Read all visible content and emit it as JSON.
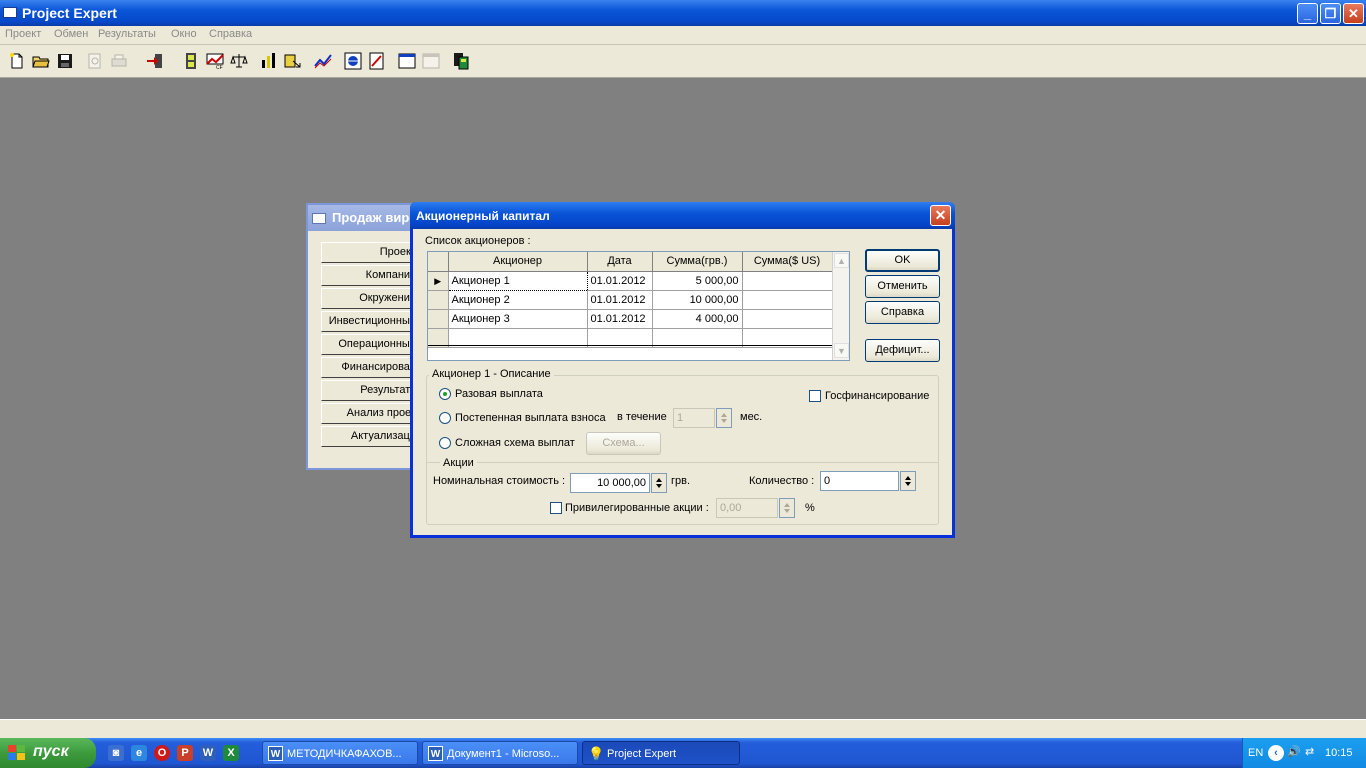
{
  "app": {
    "title": "Project Expert"
  },
  "menu": [
    "Проект",
    "Обмен",
    "Результаты",
    "Окно",
    "Справка"
  ],
  "project_window": {
    "title": "Продаж виро",
    "buttons": [
      "Проект",
      "Компания",
      "Окружение",
      "Инвестиционный",
      "Операционный",
      "Финансирован",
      "Результать",
      "Анализ проек",
      "Актуализаци"
    ]
  },
  "dialog": {
    "title": "Акционерный капитал",
    "list_label": "Список акционеров :",
    "columns": [
      "Акционер",
      "Дата",
      "Сумма(грв.)",
      "Сумма($ US)"
    ],
    "rows": [
      {
        "name": "Акционер 1",
        "date": "01.01.2012",
        "sum": "5 000,00",
        "sum_usd": ""
      },
      {
        "name": "Акционер 2",
        "date": "01.01.2012",
        "sum": "10 000,00",
        "sum_usd": ""
      },
      {
        "name": "Акционер 3",
        "date": "01.01.2012",
        "sum": "4 000,00",
        "sum_usd": ""
      }
    ],
    "buttons": {
      "ok": "OK",
      "cancel": "Отменить",
      "help": "Справка",
      "deficit": "Дефицит..."
    },
    "description": {
      "caption": "Акционер 1 - Описание",
      "one_time": "Разовая выплата",
      "gradual": "Постепенная выплата взноса",
      "during": "в течение",
      "months_value": "1",
      "months_unit": "мес.",
      "complex": "Сложная схема выплат",
      "scheme_button": "Схема...",
      "gov_funding": "Госфинансирование",
      "selected_payment": "one_time"
    },
    "shares": {
      "caption": "Акции",
      "nominal_label": "Номинальная стоимость :",
      "nominal_value": "10 000,00",
      "currency": "грв.",
      "quantity_label": "Количество :",
      "quantity_value": "0",
      "preferred_label": "Привилегированные акции :",
      "preferred_value": "0,00",
      "percent": "%"
    }
  },
  "taskbar": {
    "start": "пуск",
    "tasks": [
      "МЕТОДИЧКАФАХОВ...",
      "Документ1 - Microso...",
      "Project Expert"
    ],
    "lang": "EN",
    "clock": "10:15"
  },
  "colors": {
    "titlebar": "#0a55d8",
    "face": "#ece9d8",
    "mdi": "#808080",
    "taskbar": "#245edb",
    "start": "#3c9b3c"
  }
}
